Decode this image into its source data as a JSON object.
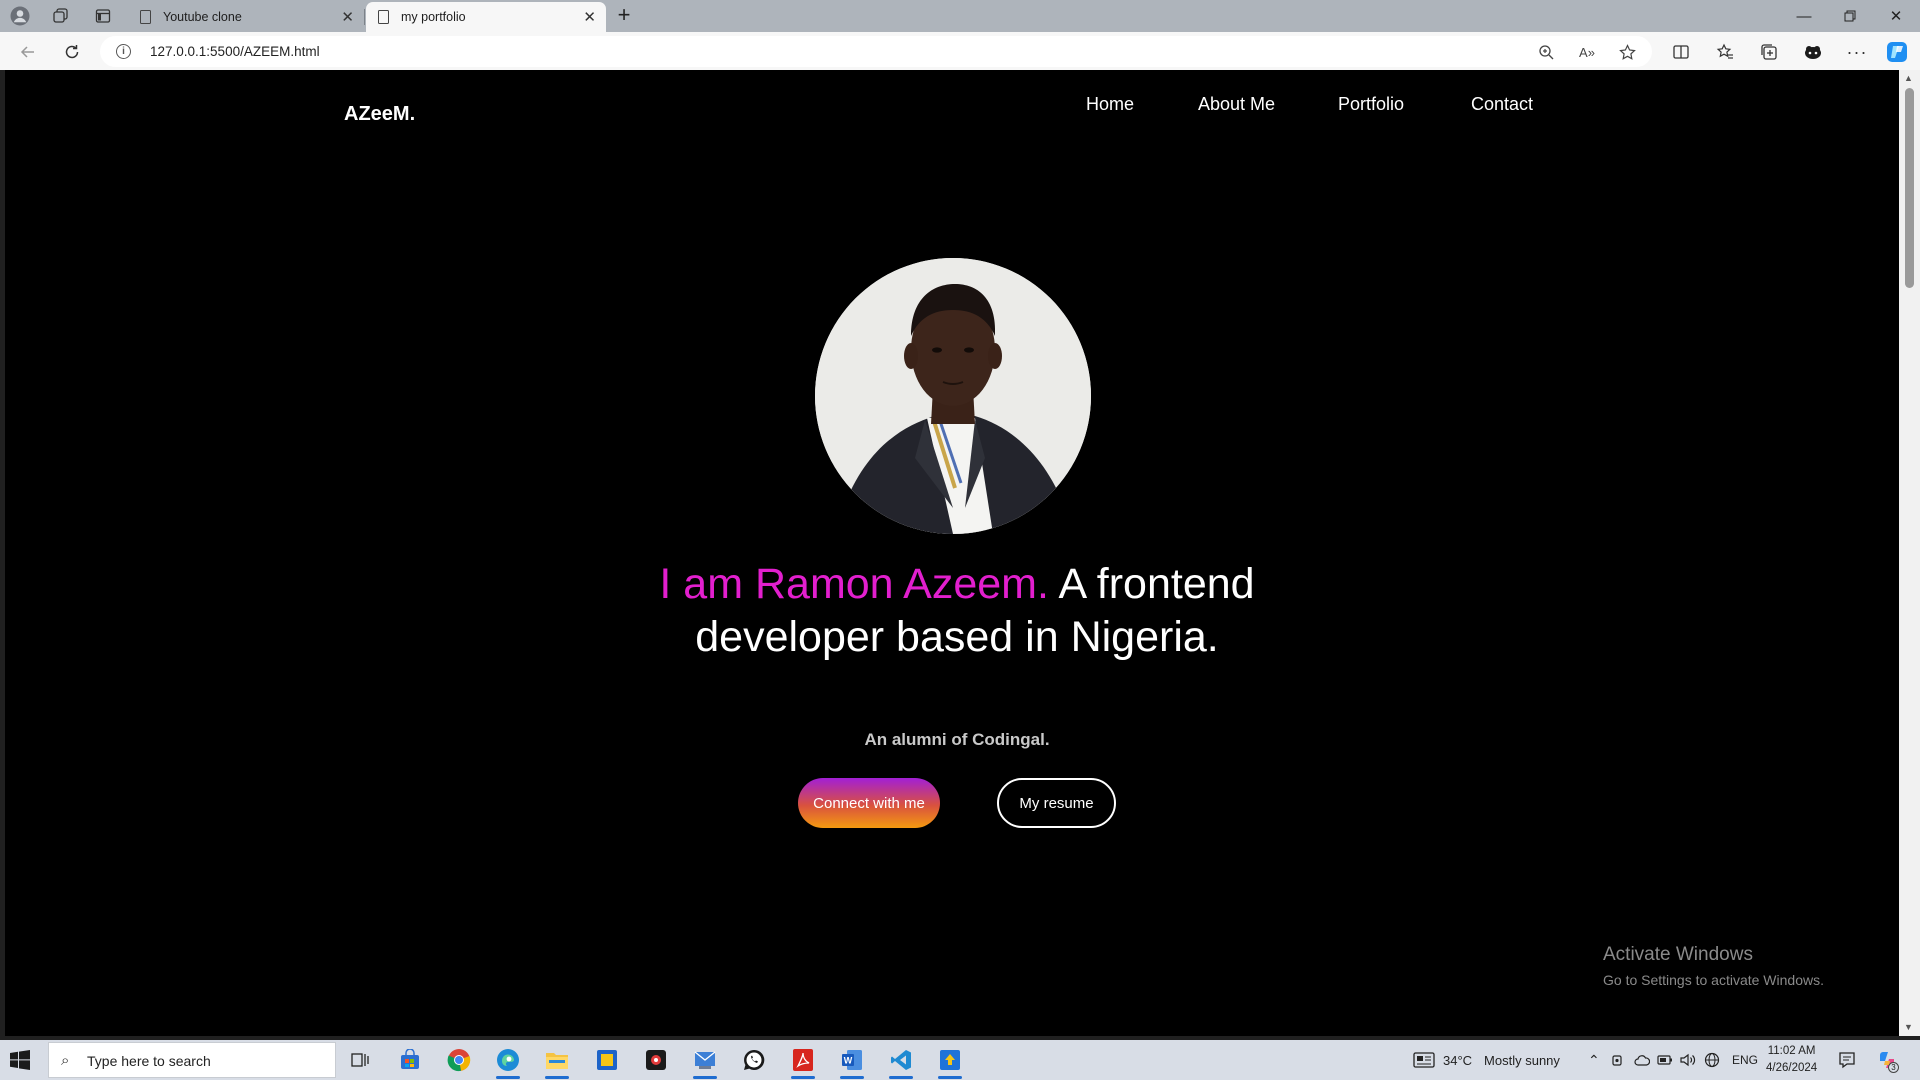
{
  "browser": {
    "tabs": [
      {
        "title": "Youtube clone",
        "active": false
      },
      {
        "title": "my portfolio",
        "active": true
      }
    ],
    "address_url": "127.0.0.1:5500/AZEEM.html"
  },
  "page": {
    "brand": "AZeeM.",
    "nav": [
      "Home",
      "About Me",
      "Portfolio",
      "Contact"
    ],
    "headline_accent": "I am Ramon Azeem.",
    "headline_rest": " A frontend developer based in Nigeria.",
    "subtitle": "An alumni of Codingal.",
    "buttons": {
      "connect": "Connect with me",
      "resume": "My resume"
    },
    "accent_color": "#e21fce"
  },
  "watermark": {
    "title": "Activate Windows",
    "subtitle": "Go to Settings to activate Windows."
  },
  "taskbar": {
    "search_placeholder": "Type here to search",
    "apps": [
      "task-view-icon",
      "store-icon",
      "chrome-icon",
      "edge-icon",
      "file-explorer-icon",
      "sticky-app-icon",
      "camera-app-icon",
      "mail-app-icon",
      "whatsapp-icon",
      "acrobat-icon",
      "word-icon",
      "vscode-icon",
      "uploader-icon"
    ],
    "weather": {
      "temp": "34°C",
      "condition": "Mostly sunny"
    },
    "language": "ENG",
    "time": "11:02 AM",
    "date": "4/26/2024",
    "notification_count": "3"
  }
}
